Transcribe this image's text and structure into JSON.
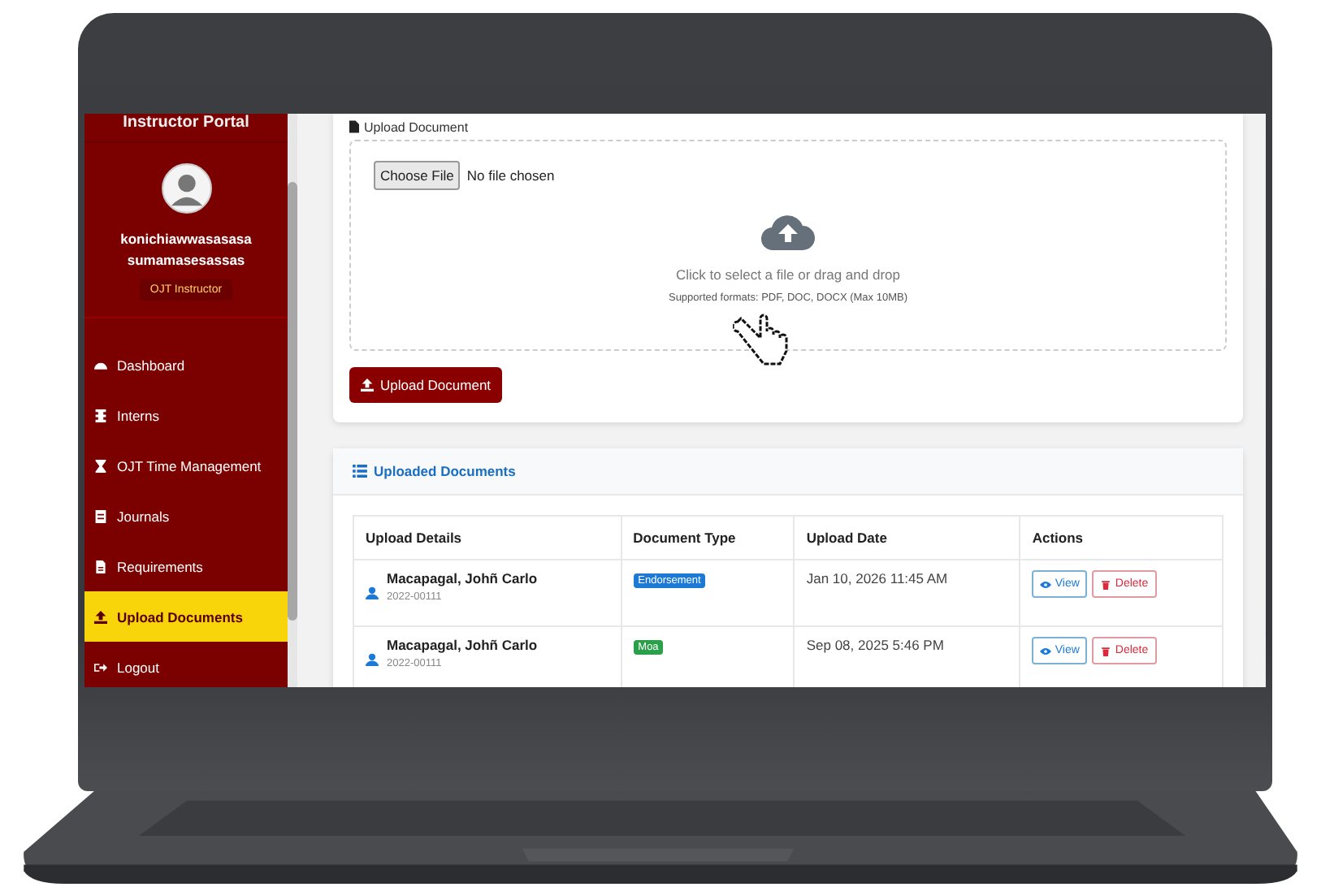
{
  "sidebar": {
    "portal_title": "Instructor Portal",
    "user_name": "konichiawwasasasa sumamasesassas",
    "role": "OJT Instructor",
    "nav": [
      {
        "label": "Dashboard",
        "selected": false
      },
      {
        "label": "Interns",
        "selected": false
      },
      {
        "label": "OJT Time Management",
        "selected": false
      },
      {
        "label": "Journals",
        "selected": false
      },
      {
        "label": "Requirements",
        "selected": false
      },
      {
        "label": "Upload Documents",
        "selected": true
      },
      {
        "label": "Logout",
        "selected": false
      }
    ]
  },
  "upload": {
    "section_label": "Upload Document",
    "file_button": "Choose File",
    "file_status": "No file chosen",
    "drop_text": "Click to select a file or drag and drop",
    "formats": "Supported formats: PDF, DOC, DOCX (Max 10MB)",
    "submit": "Upload Document"
  },
  "documents": {
    "title": "Uploaded Documents",
    "columns": [
      "Upload Details",
      "Document Type",
      "Upload Date",
      "Actions"
    ],
    "rows": [
      {
        "name": "Macapagal, Johñ Carlo",
        "id": "2022-00111",
        "type": {
          "label": "Endorsement",
          "color": "#1c7ad6"
        },
        "date": "Jan 10, 2026 11:45 AM",
        "actions": [
          "View",
          "Delete"
        ]
      },
      {
        "name": "Macapagal, Johñ Carlo",
        "id": "2022-00111",
        "type": {
          "label": "Moa",
          "color": "#2aa04a"
        },
        "date": "Sep 08, 2025 5:46 PM",
        "actions": [
          "View",
          "Delete"
        ]
      }
    ]
  }
}
